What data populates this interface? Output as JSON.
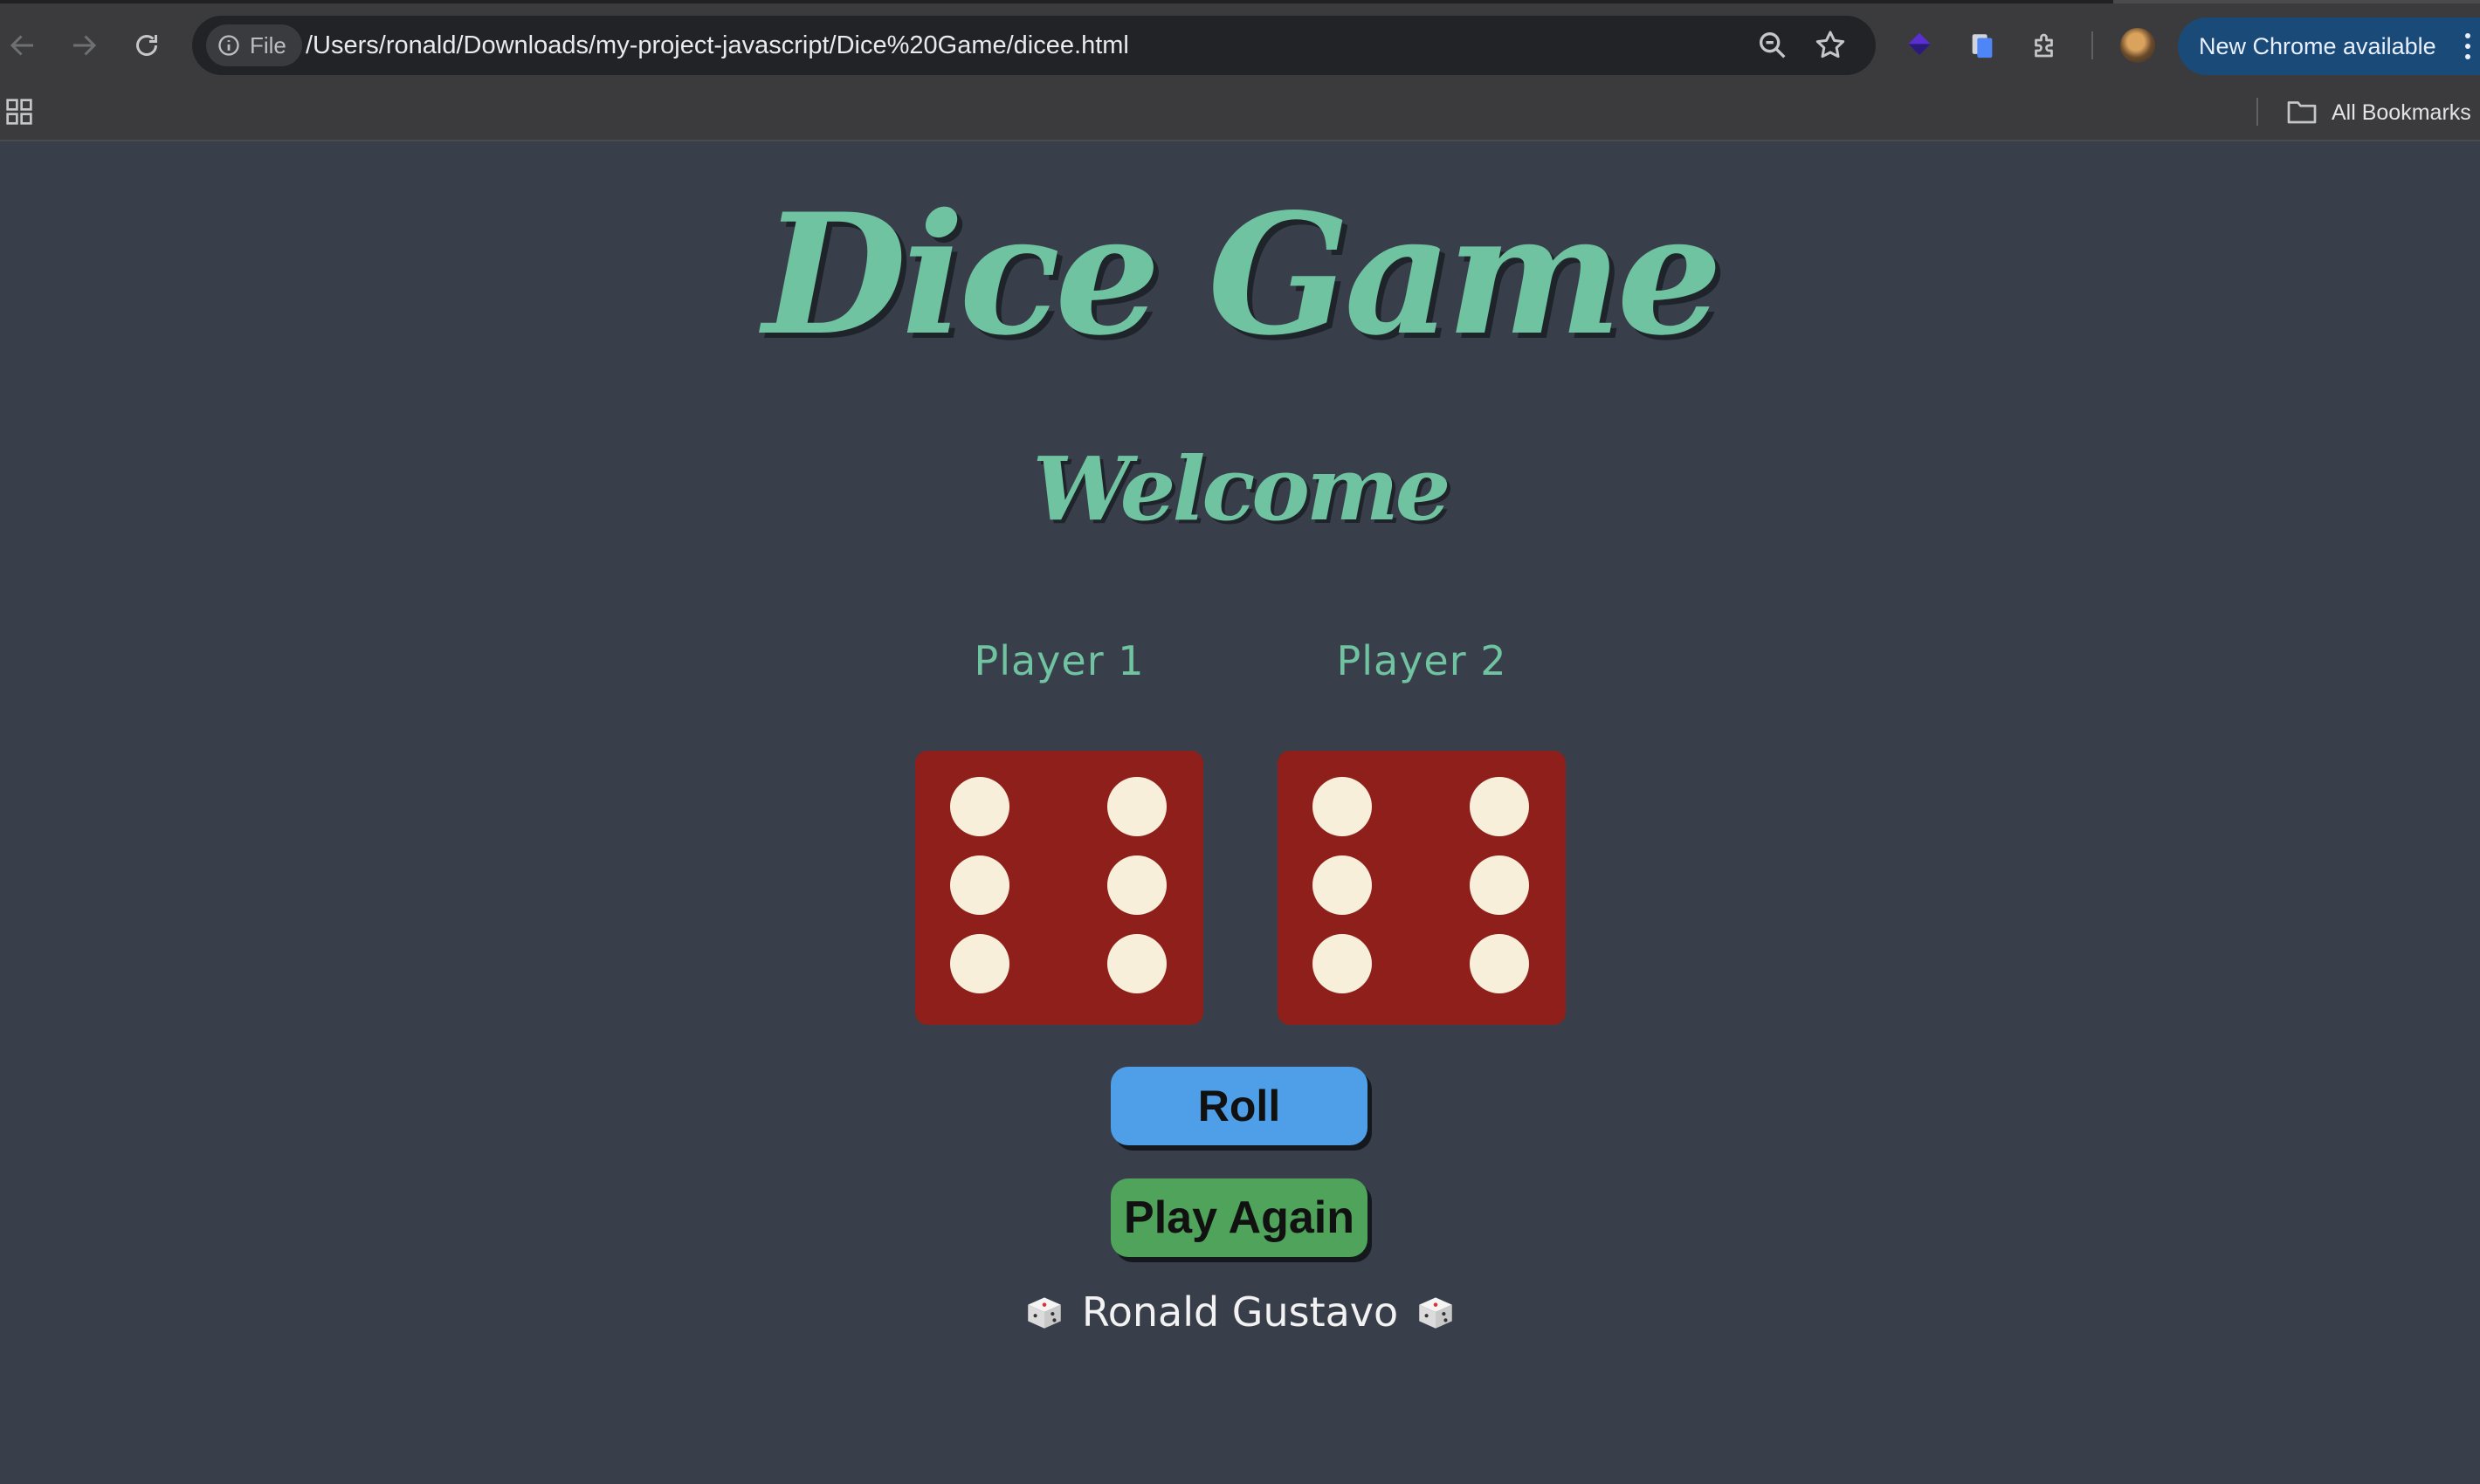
{
  "browser": {
    "site_chip": "File",
    "url": "/Users/ronald/Downloads/my-project-javascript/Dice%20Game/dicee.html",
    "update_button": "New Chrome available",
    "bookmarks_label": "All Bookmarks"
  },
  "page": {
    "title": "Dice Game",
    "subtitle": "Welcome",
    "player1_label": "Player 1",
    "player2_label": "Player 2",
    "player1_die_value": 6,
    "player2_die_value": 6,
    "roll_button": "Roll",
    "play_again_button": "Play Again",
    "footer_name": "Ronald Gustavo"
  },
  "colors": {
    "background": "#393f4a",
    "accent_green": "#6fc3a0",
    "die_red": "#8e1f1a",
    "pip_cream": "#f8efda",
    "roll_blue": "#4f9ee8",
    "play_again_green": "#4fa35a"
  },
  "icons": [
    "back-icon",
    "forward-icon",
    "reload-icon",
    "info-icon",
    "zoom-icon",
    "star-icon",
    "extension-icon",
    "puzzle-icon",
    "apps-icon",
    "folder-icon",
    "dice-icon"
  ]
}
